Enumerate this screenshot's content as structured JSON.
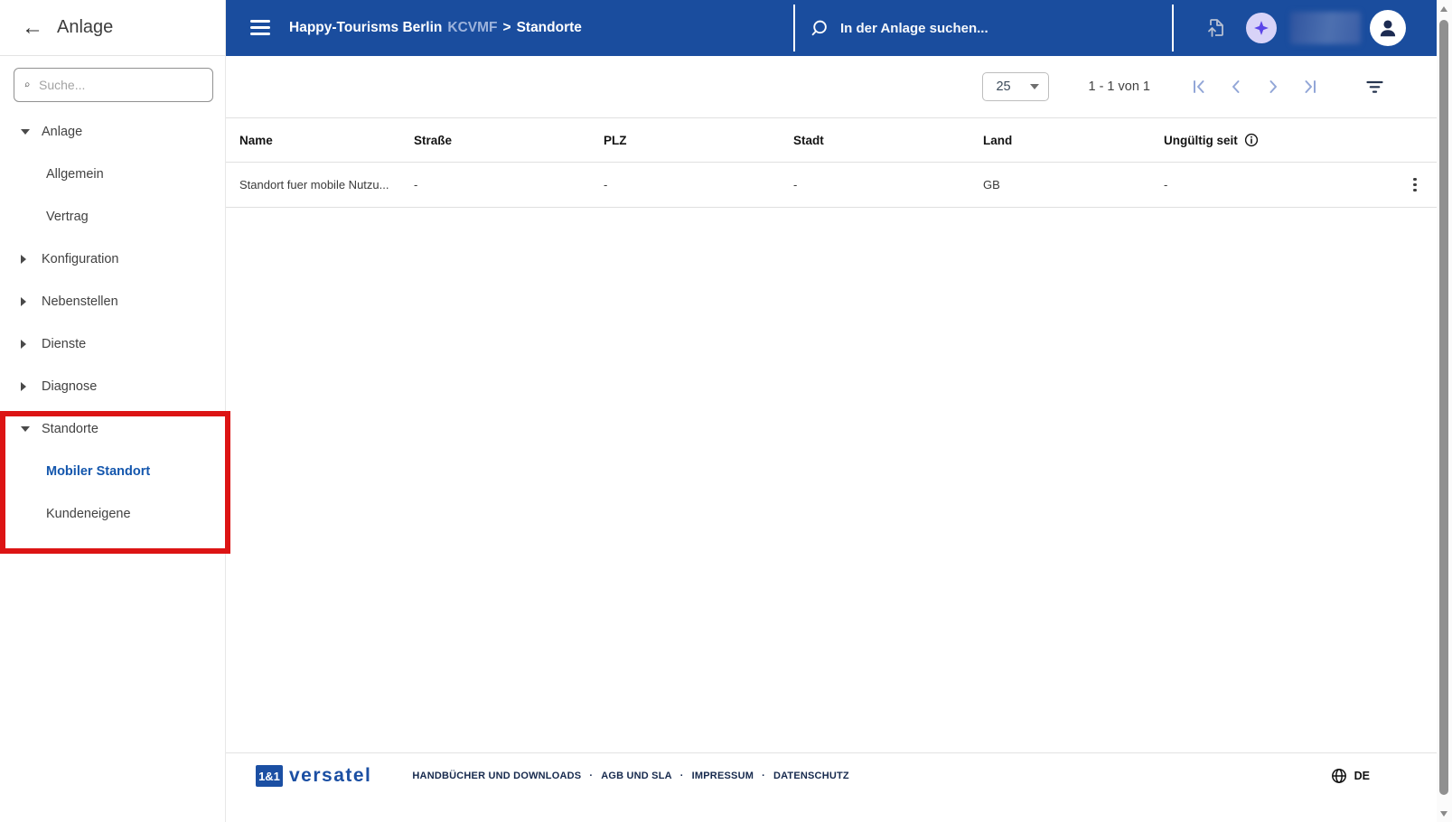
{
  "colors": {
    "topbar_blue": "#1a4d9e",
    "active_link_blue": "#1356ad",
    "annotation_red": "#dc1414",
    "ai_badge_bg": "#d8d3f8",
    "ai_badge_star": "#5b45e8",
    "logo_blue": "#1b4fa3"
  },
  "sidebar": {
    "title": "Anlage",
    "search_placeholder": "Suche...",
    "items": [
      {
        "label": "Anlage",
        "state": "expanded"
      },
      {
        "label": "Allgemein"
      },
      {
        "label": "Vertrag"
      },
      {
        "label": "Konfiguration",
        "state": "collapsed"
      },
      {
        "label": "Nebenstellen",
        "state": "collapsed"
      },
      {
        "label": "Dienste",
        "state": "collapsed"
      },
      {
        "label": "Diagnose",
        "state": "collapsed"
      },
      {
        "label": "Standorte",
        "state": "expanded"
      },
      {
        "label": "Mobiler Standort",
        "active": true
      },
      {
        "label": "Kundeneigene"
      }
    ]
  },
  "topbar": {
    "breadcrumb": {
      "account": "Happy-Tourisms Berlin",
      "code": "KCVMF",
      "separator": ">",
      "current": "Standorte"
    },
    "search_placeholder": "In der Anlage suchen..."
  },
  "toolbar": {
    "page_size": "25",
    "range_label": "1 - 1 von 1"
  },
  "table": {
    "columns": [
      "Name",
      "Straße",
      "PLZ",
      "Stadt",
      "Land",
      "Ungültig seit"
    ],
    "rows": [
      {
        "name": "Standort fuer mobile Nutzu...",
        "strasse": "-",
        "plz": "-",
        "stadt": "-",
        "land": "GB",
        "ungueltig_seit": "-"
      }
    ]
  },
  "footer": {
    "logo_box": "1&1",
    "logo_word": "versatel",
    "links": [
      "HANDBÜCHER UND DOWNLOADS",
      "AGB UND SLA",
      "IMPRESSUM",
      "DATENSCHUTZ"
    ],
    "separator": "·",
    "language": "DE"
  }
}
